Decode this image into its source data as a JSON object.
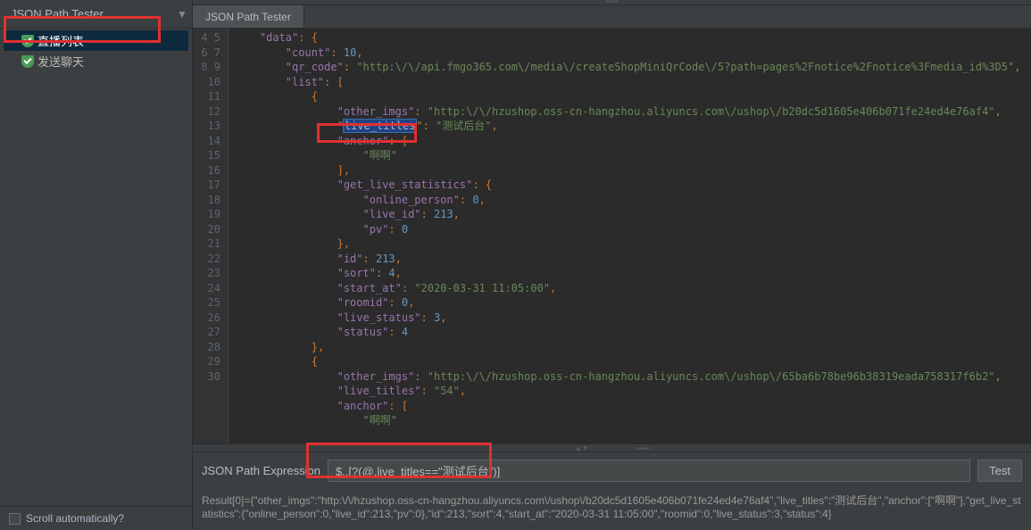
{
  "leftPanel": {
    "tabLabel": "JSON Path Tester",
    "items": [
      "直播列表",
      "发送聊天"
    ],
    "scrollLabel": "Scroll automatically?"
  },
  "rightPanel": {
    "tabLabel": "JSON Path Tester"
  },
  "code": {
    "startLine": 4,
    "endLine": 30,
    "lines": [
      {
        "i": 0,
        "t": "    \"data\": {"
      },
      {
        "i": 1,
        "t": "        \"count\": 10,",
        "num": "10"
      },
      {
        "i": 2,
        "t": "        \"qr_code\": \"http:\\/\\/api.fmgo365.com\\/media\\/createShopMiniQrCode\\/5?path=pages%2Fnotice%2Fnotice%3Fmedia_id%3D5\","
      },
      {
        "i": 3,
        "t": "        \"list\": ["
      },
      {
        "i": 4,
        "t": "            {"
      },
      {
        "i": 5,
        "t": "                \"other_imgs\": \"http:\\/\\/hzushop.oss-cn-hangzhou.aliyuncs.com\\/ushop\\/b20dc5d1605e406b071fe24ed4e76af4\","
      },
      {
        "i": 6,
        "t": "                \"live_titles\": \"测试后台\",",
        "hl": "live_titles"
      },
      {
        "i": 7,
        "t": "                \"anchor\": ["
      },
      {
        "i": 8,
        "t": "                    \"啊啊\""
      },
      {
        "i": 9,
        "t": "                ],"
      },
      {
        "i": 10,
        "t": "                \"get_live_statistics\": {"
      },
      {
        "i": 11,
        "t": "                    \"online_person\": 0,",
        "num": "0"
      },
      {
        "i": 12,
        "t": "                    \"live_id\": 213,",
        "num": "213"
      },
      {
        "i": 13,
        "t": "                    \"pv\": 0",
        "num": "0"
      },
      {
        "i": 14,
        "t": "                },"
      },
      {
        "i": 15,
        "t": "                \"id\": 213,",
        "num": "213"
      },
      {
        "i": 16,
        "t": "                \"sort\": 4,",
        "num": "4"
      },
      {
        "i": 17,
        "t": "                \"start_at\": \"2020-03-31 11:05:00\","
      },
      {
        "i": 18,
        "t": "                \"roomid\": 0,",
        "num": "0"
      },
      {
        "i": 19,
        "t": "                \"live_status\": 3,",
        "num": "3"
      },
      {
        "i": 20,
        "t": "                \"status\": 4",
        "num": "4"
      },
      {
        "i": 21,
        "t": "            },"
      },
      {
        "i": 22,
        "t": "            {"
      },
      {
        "i": 23,
        "t": "                \"other_imgs\": \"http:\\/\\/hzushop.oss-cn-hangzhou.aliyuncs.com\\/ushop\\/65ba6b78be96b38319eada758317f6b2\","
      },
      {
        "i": 24,
        "t": "                \"live_titles\": \"54\","
      },
      {
        "i": 25,
        "t": "                \"anchor\": ["
      },
      {
        "i": 26,
        "t": "                    \"啊啊\""
      }
    ]
  },
  "expression": {
    "label": "JSON Path Expression",
    "value": "$..[?(@.live_titles==\"测试后台\")]",
    "testLabel": "Test"
  },
  "result": "Result[0]={\"other_imgs\":\"http:\\/\\/hzushop.oss-cn-hangzhou.aliyuncs.com\\/ushop\\/b20dc5d1605e406b071fe24ed4e76af4\",\"live_titles\":\"测试后台\",\"anchor\":[\"啊啊\"],\"get_live_statistics\":{\"online_person\":0,\"live_id\":213,\"pv\":0},\"id\":213,\"sort\":4,\"start_at\":\"2020-03-31 11:05:00\",\"roomid\":0,\"live_status\":3,\"status\":4}"
}
